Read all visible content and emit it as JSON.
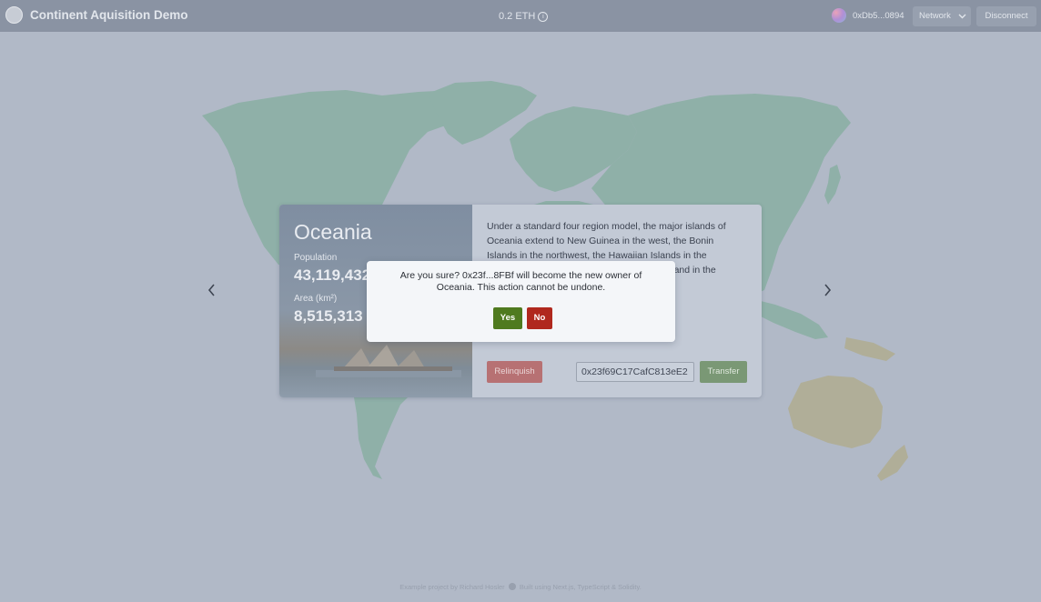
{
  "header": {
    "app_title": "Continent Aquisition Demo",
    "balance": "0.2 ETH",
    "info_icon": "ⓘ",
    "wallet_address": "0xDb5...0894",
    "network_label": "Network",
    "disconnect_label": "Disconnect"
  },
  "map": {
    "prev_arrow": "‹",
    "next_arrow": "›",
    "colors": {
      "background": "#b1b9c7",
      "continent": "#8fb0a8",
      "selected_continent": "#b0ae98"
    }
  },
  "card": {
    "continent_name": "Oceania",
    "population_label": "Population",
    "population_value": "43,119,432",
    "area_label": "Area (km²)",
    "area_value": "8,515,313",
    "description": "Under a standard four region model, the major islands of Oceania extend to New Guinea in the west, the Bonin Islands in the northwest, the Hawaiian Islands in the",
    "description_tail": "sland in the",
    "relinquish_label": "Relinquish",
    "transfer_input_value": "0x23f69C17CafC813eE2",
    "transfer_label": "Transfer"
  },
  "dialog": {
    "message": "Are you sure? 0x23f...8FBf will become the new owner of Oceania. This action cannot be undone.",
    "yes_label": "Yes",
    "no_label": "No"
  },
  "footer": {
    "credit": "Example project by Richard Hosler",
    "built_with": "Built using Next.js, TypeScript & Solidity."
  }
}
